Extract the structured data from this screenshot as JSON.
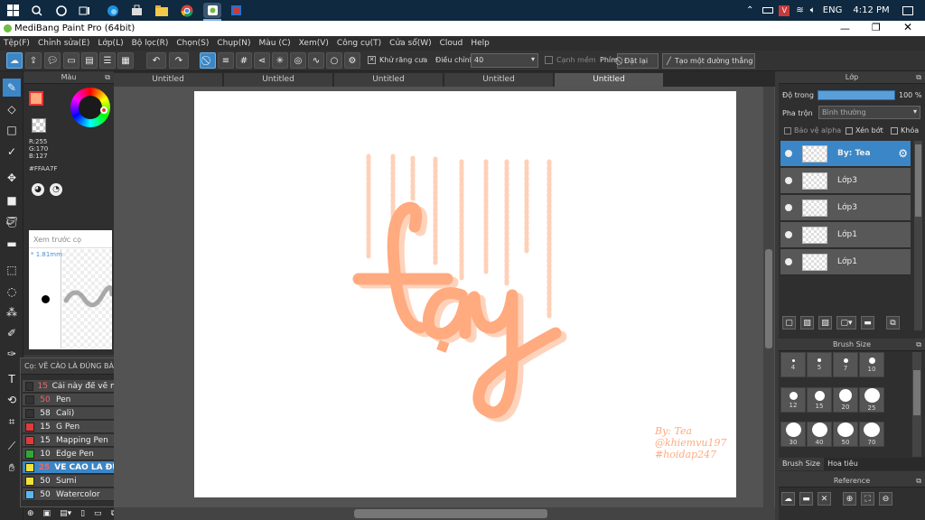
{
  "taskbar": {
    "tray": {
      "language": "ENG",
      "time": "4:12 PM"
    }
  },
  "window": {
    "title": "MediBang Paint Pro (64bit)"
  },
  "menu": [
    "Tệp(F)",
    "Chỉnh sửa(E)",
    "Lớp(L)",
    "Bộ lọc(R)",
    "Chọn(S)",
    "Chụp(N)",
    "Màu (C)",
    "Xem(V)",
    "Công cụ(T)",
    "Cửa sổ(W)",
    "Cloud",
    "Help"
  ],
  "toolbar": {
    "antialias_label": "Khử răng cưa",
    "adjust_label": "Điều chỉnh",
    "adjust_value": "40",
    "soft_edge_label": "Cạnh mềm",
    "key_label": "Phím",
    "reset_label": "Đặt lại",
    "straight_line_label": "Tạo một đường thẳng"
  },
  "tabs": [
    "Untitled",
    "Untitled",
    "Untitled",
    "Untitled",
    "Untitled"
  ],
  "color_panel": {
    "title": "Màu",
    "r": "R:255",
    "g": "G:170",
    "b": "B:127",
    "hex": "#FFAA7F",
    "primary_color": "#FFAA7F"
  },
  "preview_panel": {
    "title": "Xem trước cọ",
    "size": "* 1.81mm"
  },
  "brush_panel": {
    "title": "Cọ: VẼ CÀO LÀ ĐÚNG BÀI",
    "brushes": [
      {
        "size": "15",
        "name": "Cái này để vẽ mắm,mắt,...",
        "color": "#333333"
      },
      {
        "size": "50",
        "name": "Pen",
        "color": "#333333"
      },
      {
        "size": "58",
        "name": "Cali)",
        "color": "#333333"
      },
      {
        "size": "15",
        "name": "G Pen",
        "color": "#e03a3a"
      },
      {
        "size": "15",
        "name": "Mapping Pen",
        "color": "#e03a3a"
      },
      {
        "size": "10",
        "name": "Edge Pen",
        "color": "#2eaa33"
      },
      {
        "size": "25",
        "name": "VẼ CÀO LÀ ĐÚNG BÀI",
        "color": "#f2e23a"
      },
      {
        "size": "50",
        "name": "Sumi",
        "color": "#f2e23a"
      },
      {
        "size": "50",
        "name": "Watercolor",
        "color": "#5ab8f0"
      }
    ]
  },
  "canvas": {
    "text": "lạy",
    "credit_lines": [
      "By: Tea",
      "@khiemvu197",
      "#hoidap247"
    ],
    "art_color": "#FFAA7F"
  },
  "layer_panel": {
    "title": "Lớp",
    "opacity_label": "Độ trong",
    "opacity_value": "100 %",
    "blend_label": "Pha trộn",
    "blend_value": "Bình thường",
    "protect_alpha": "Bảo vệ alpha",
    "clipping": "Xén bớt",
    "lock": "Khóa",
    "layers": [
      "By: Tea",
      "Lớp3",
      "Lớp3",
      "Lớp1",
      "Lớp1"
    ]
  },
  "brush_size_panel": {
    "title": "Brush Size",
    "sizes": [
      "4",
      "5",
      "7",
      "10",
      "12",
      "15",
      "20",
      "25",
      "30",
      "40",
      "50",
      "70"
    ],
    "tab1": "Brush Size",
    "tab2": "Hoa tiêu"
  },
  "reference_panel": {
    "title": "Reference"
  }
}
